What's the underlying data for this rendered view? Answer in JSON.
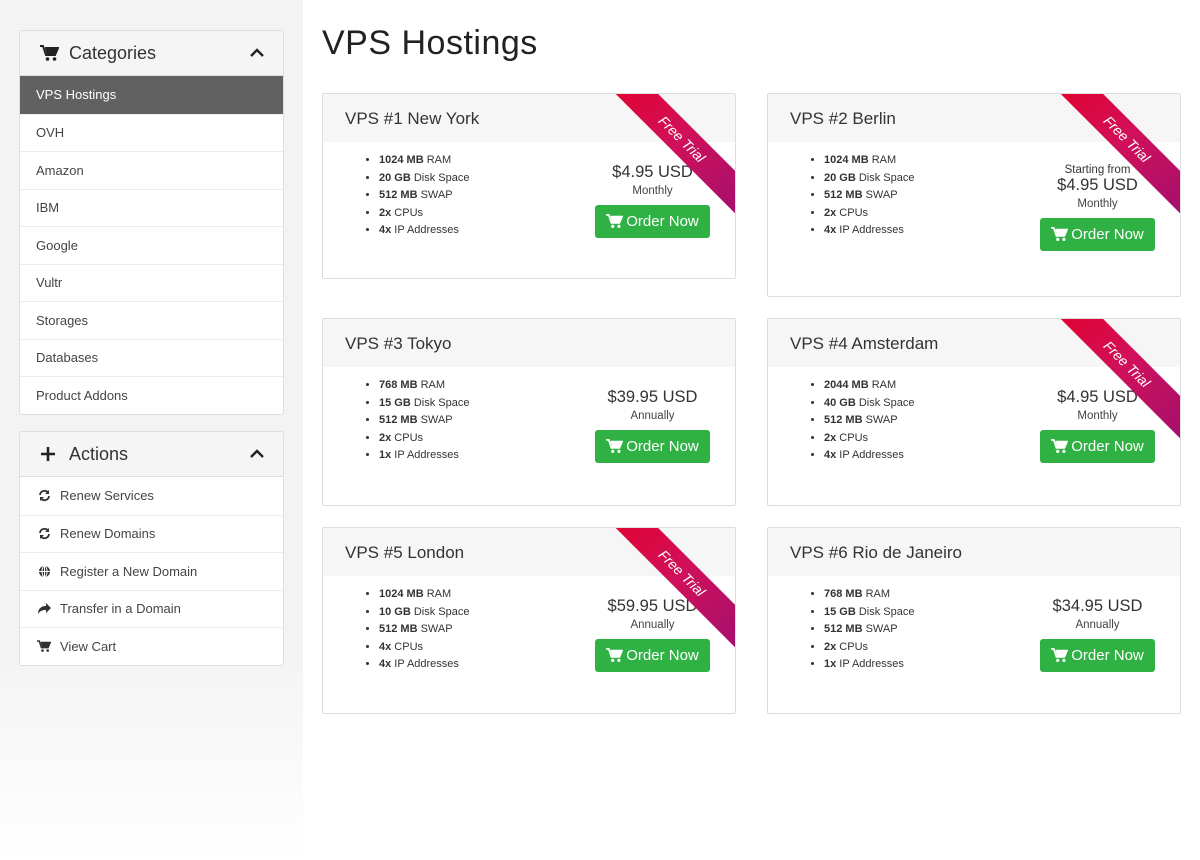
{
  "sidebar": {
    "categories": {
      "title": "Categories",
      "icon": "cart-icon",
      "items": [
        {
          "label": "VPS Hostings",
          "active": true
        },
        {
          "label": "OVH"
        },
        {
          "label": "Amazon"
        },
        {
          "label": "IBM"
        },
        {
          "label": "Google"
        },
        {
          "label": "Vultr"
        },
        {
          "label": "Storages"
        },
        {
          "label": "Databases"
        },
        {
          "label": "Product Addons"
        }
      ]
    },
    "actions": {
      "title": "Actions",
      "icon": "plus-icon",
      "items": [
        {
          "label": "Renew Services",
          "icon": "refresh-icon"
        },
        {
          "label": "Renew Domains",
          "icon": "refresh-icon"
        },
        {
          "label": "Register a New Domain",
          "icon": "globe-icon"
        },
        {
          "label": "Transfer in a Domain",
          "icon": "share-arrow-icon"
        },
        {
          "label": "View Cart",
          "icon": "cart-icon"
        }
      ]
    }
  },
  "main": {
    "title": "VPS Hostings",
    "ribbon_text": "Free Trial",
    "order_label": "Order Now",
    "products": [
      {
        "name": "VPS #1 New York",
        "free_trial": true,
        "starting_from": "",
        "price": "$4.95 USD",
        "cycle": "Monthly",
        "features": [
          {
            "value": "1024 MB",
            "label": " RAM"
          },
          {
            "value": "20 GB",
            "label": " Disk Space"
          },
          {
            "value": "512 MB",
            "label": " SWAP"
          },
          {
            "value": "2x",
            "label": " CPUs"
          },
          {
            "value": "4x",
            "label": " IP Addresses"
          }
        ]
      },
      {
        "name": "VPS #2 Berlin",
        "free_trial": true,
        "starting_from": "Starting from",
        "price": "$4.95 USD",
        "cycle": "Monthly",
        "features": [
          {
            "value": "1024 MB",
            "label": " RAM"
          },
          {
            "value": "20 GB",
            "label": " Disk Space"
          },
          {
            "value": "512 MB",
            "label": " SWAP"
          },
          {
            "value": "2x",
            "label": " CPUs"
          },
          {
            "value": "4x",
            "label": " IP Addresses"
          }
        ]
      },
      {
        "name": "VPS #3 Tokyo",
        "free_trial": false,
        "starting_from": "",
        "price": "$39.95 USD",
        "cycle": "Annually",
        "features": [
          {
            "value": "768 MB",
            "label": " RAM"
          },
          {
            "value": "15 GB",
            "label": " Disk Space"
          },
          {
            "value": "512 MB",
            "label": " SWAP"
          },
          {
            "value": "2x",
            "label": " CPUs"
          },
          {
            "value": "1x",
            "label": " IP Addresses"
          }
        ]
      },
      {
        "name": "VPS #4 Amsterdam",
        "free_trial": true,
        "starting_from": "",
        "price": "$4.95 USD",
        "cycle": "Monthly",
        "features": [
          {
            "value": "2044 MB",
            "label": " RAM"
          },
          {
            "value": "40 GB",
            "label": " Disk Space"
          },
          {
            "value": "512 MB",
            "label": " SWAP"
          },
          {
            "value": "2x",
            "label": " CPUs"
          },
          {
            "value": "4x",
            "label": " IP Addresses"
          }
        ]
      },
      {
        "name": "VPS #5 London",
        "free_trial": true,
        "starting_from": "",
        "price": "$59.95 USD",
        "cycle": "Annually",
        "features": [
          {
            "value": "1024 MB",
            "label": " RAM"
          },
          {
            "value": "10 GB",
            "label": " Disk Space"
          },
          {
            "value": "512 MB",
            "label": " SWAP"
          },
          {
            "value": "4x",
            "label": " CPUs"
          },
          {
            "value": "4x",
            "label": " IP Addresses"
          }
        ]
      },
      {
        "name": "VPS #6 Rio de Janeiro",
        "free_trial": false,
        "starting_from": "",
        "price": "$34.95 USD",
        "cycle": "Annually",
        "features": [
          {
            "value": "768 MB",
            "label": " RAM"
          },
          {
            "value": "15 GB",
            "label": " Disk Space"
          },
          {
            "value": "512 MB",
            "label": " SWAP"
          },
          {
            "value": "2x",
            "label": " CPUs"
          },
          {
            "value": "1x",
            "label": " IP Addresses"
          }
        ]
      }
    ]
  },
  "colors": {
    "order_button": "#2fb144",
    "active_category": "#616161",
    "ribbon_start": "#e4002b",
    "ribbon_end": "#a30f6e"
  }
}
